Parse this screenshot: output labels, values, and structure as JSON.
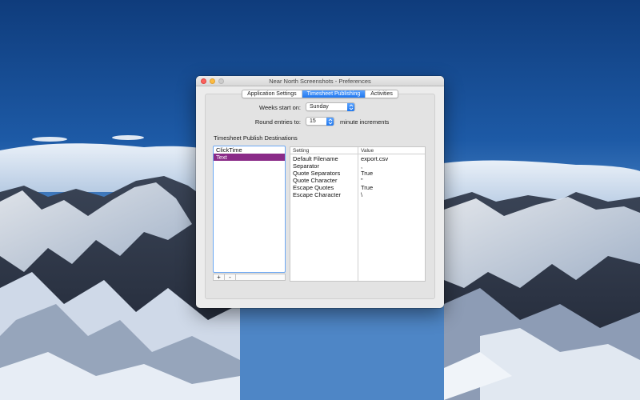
{
  "window": {
    "title": "Near North Screenshots - Preferences"
  },
  "tabs": [
    {
      "label": "Application Settings",
      "active": false
    },
    {
      "label": "Timesheet Publishing",
      "active": true
    },
    {
      "label": "Activities",
      "active": false
    }
  ],
  "form": {
    "weeks_label": "Weeks start on:",
    "weeks_value": "Sunday",
    "round_label": "Round entries to:",
    "round_value": "15",
    "round_suffix": "minute increments"
  },
  "destinations": {
    "section_label": "Timesheet Publish Destinations",
    "items": [
      {
        "label": "ClickTime",
        "selected": false
      },
      {
        "label": "Text",
        "selected": true
      }
    ],
    "add_label": "+",
    "remove_label": "-"
  },
  "settings_table": {
    "columns": [
      "Setting",
      "Value"
    ],
    "rows": [
      {
        "setting": "Default Filename",
        "value": "export.csv"
      },
      {
        "setting": "Separator",
        "value": ","
      },
      {
        "setting": "Quote Separators",
        "value": "True"
      },
      {
        "setting": "Quote Character",
        "value": "\""
      },
      {
        "setting": "Escape Quotes",
        "value": "True"
      },
      {
        "setting": "Escape Character",
        "value": "\\"
      }
    ]
  },
  "colors": {
    "accent": "#1f77ee",
    "selection": "#8a2b88",
    "close": "#fc615d",
    "minimize": "#fdbc40"
  }
}
